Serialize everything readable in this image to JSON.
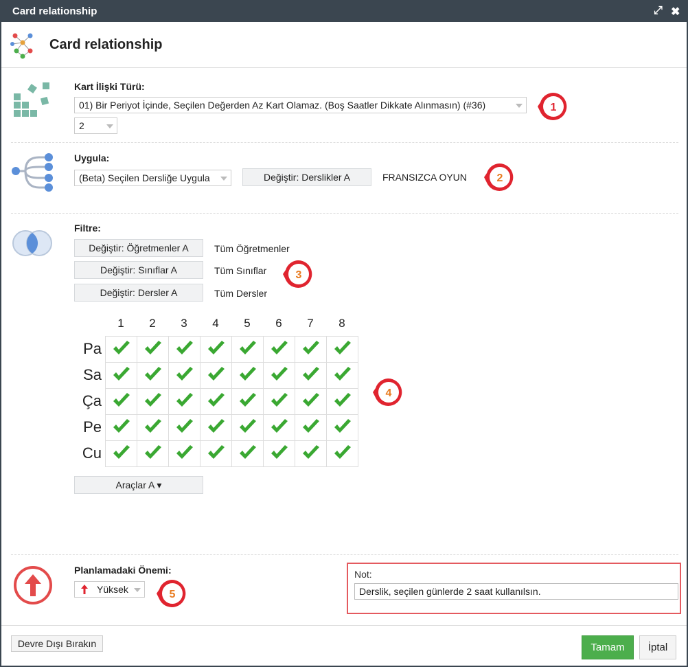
{
  "window": {
    "title": "Card relationship"
  },
  "header": {
    "title": "Card relationship"
  },
  "relation": {
    "label": "Kart İlişki Türü:",
    "type_value": "01) Bir Periyot İçinde, Seçilen Değerden Az Kart Olamaz. (Boş Saatler Dikkate Alınmasın) (#36)",
    "count_value": "2"
  },
  "apply": {
    "label": "Uygula:",
    "mode_value": "(Beta) Seçilen Dersliğe Uygula",
    "change_button": "Değiştir: Derslikler A",
    "selected_text": "FRANSIZCA OYUN"
  },
  "filter": {
    "label": "Filtre:",
    "rows": [
      {
        "button": "Değiştir: Öğretmenler A",
        "value": "Tüm Öğretmenler"
      },
      {
        "button": "Değiştir: Sınıflar A",
        "value": "Tüm Sınıflar"
      },
      {
        "button": "Değiştir: Dersler A",
        "value": "Tüm Dersler"
      }
    ]
  },
  "grid": {
    "periods": [
      "1",
      "2",
      "3",
      "4",
      "5",
      "6",
      "7",
      "8"
    ],
    "days": [
      "Pa",
      "Sa",
      "Ça",
      "Pe",
      "Cu"
    ],
    "all_checked": true,
    "tools_button": "Araçlar A ▾"
  },
  "importance": {
    "label": "Planlamadaki Önemi:",
    "value": "Yüksek"
  },
  "note": {
    "label": "Not:",
    "value": "Derslik, seçilen günlerde 2 saat kullanılsın."
  },
  "footer": {
    "disable_button": "Devre Dışı Bırakın",
    "ok_button": "Tamam",
    "cancel_button": "İptal"
  },
  "callouts": [
    "1",
    "2",
    "3",
    "4",
    "5"
  ],
  "colors": {
    "titlebar": "#3b4650",
    "check": "#3aa832",
    "callout": "#e0242f",
    "ok": "#4cae4c",
    "icon_teal": "#7ab8a6",
    "icon_blue": "#5b8fd9"
  }
}
